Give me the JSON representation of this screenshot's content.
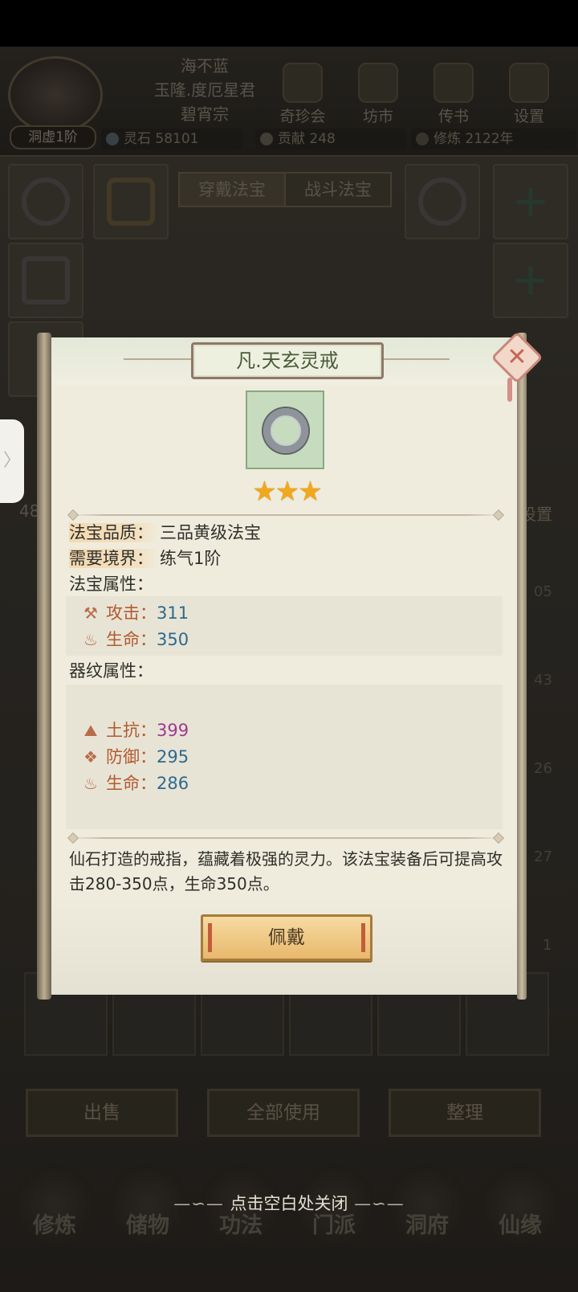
{
  "header": {
    "player_name": "海不蓝",
    "title": "玉隆.度厄星君",
    "sect": "碧宵宗",
    "rank": "洞虚1阶",
    "menu": [
      "奇珍会",
      "坊市",
      "传书",
      "设置"
    ],
    "resources": [
      {
        "label": "灵石",
        "value": "58101"
      },
      {
        "label": "贡献",
        "value": "248"
      },
      {
        "label": "修炼",
        "value": "2122年"
      }
    ]
  },
  "equip_tabs": [
    "穿戴法宝",
    "战斗法宝"
  ],
  "bag_side_labels": {
    "left_count": "48",
    "right_label": "设置"
  },
  "bag_counts": [
    "05",
    "43",
    "26",
    "27",
    "1"
  ],
  "bottom_actions": [
    "出售",
    "全部使用",
    "整理"
  ],
  "nav": [
    "修炼",
    "储物",
    "功法",
    "门派",
    "洞府",
    "仙缘"
  ],
  "close_hint": "点击空白处关闭",
  "modal": {
    "title": "凡.天玄灵戒",
    "stars": "★★★",
    "star_count": 3,
    "quality_label": "法宝品质：",
    "quality_value": "三品黄级法宝",
    "realm_label": "需要境界：",
    "realm_value": "练气1阶",
    "attr_header": "法宝属性：",
    "attributes": [
      {
        "icon": "attack-icon",
        "label": "攻击：",
        "value": "311"
      },
      {
        "icon": "life-icon",
        "label": "生命：",
        "value": "350"
      }
    ],
    "rune_header": "器纹属性：",
    "rune_attributes": [
      {
        "icon": "earth-resist-icon",
        "label": "土抗：",
        "value": "399"
      },
      {
        "icon": "defense-icon",
        "label": "防御：",
        "value": "295"
      },
      {
        "icon": "life-icon",
        "label": "生命：",
        "value": "286"
      }
    ],
    "description": "仙石打造的戒指，蕴藏着极强的灵力。该法宝装备后可提高攻击280-350点，生命350点。",
    "wear_button": "佩戴"
  },
  "colors": {
    "value_blue": "#2c6a8e",
    "value_purple": "#a0388e",
    "label_brown": "#b35a2e",
    "star_gold": "#f2a81c"
  }
}
